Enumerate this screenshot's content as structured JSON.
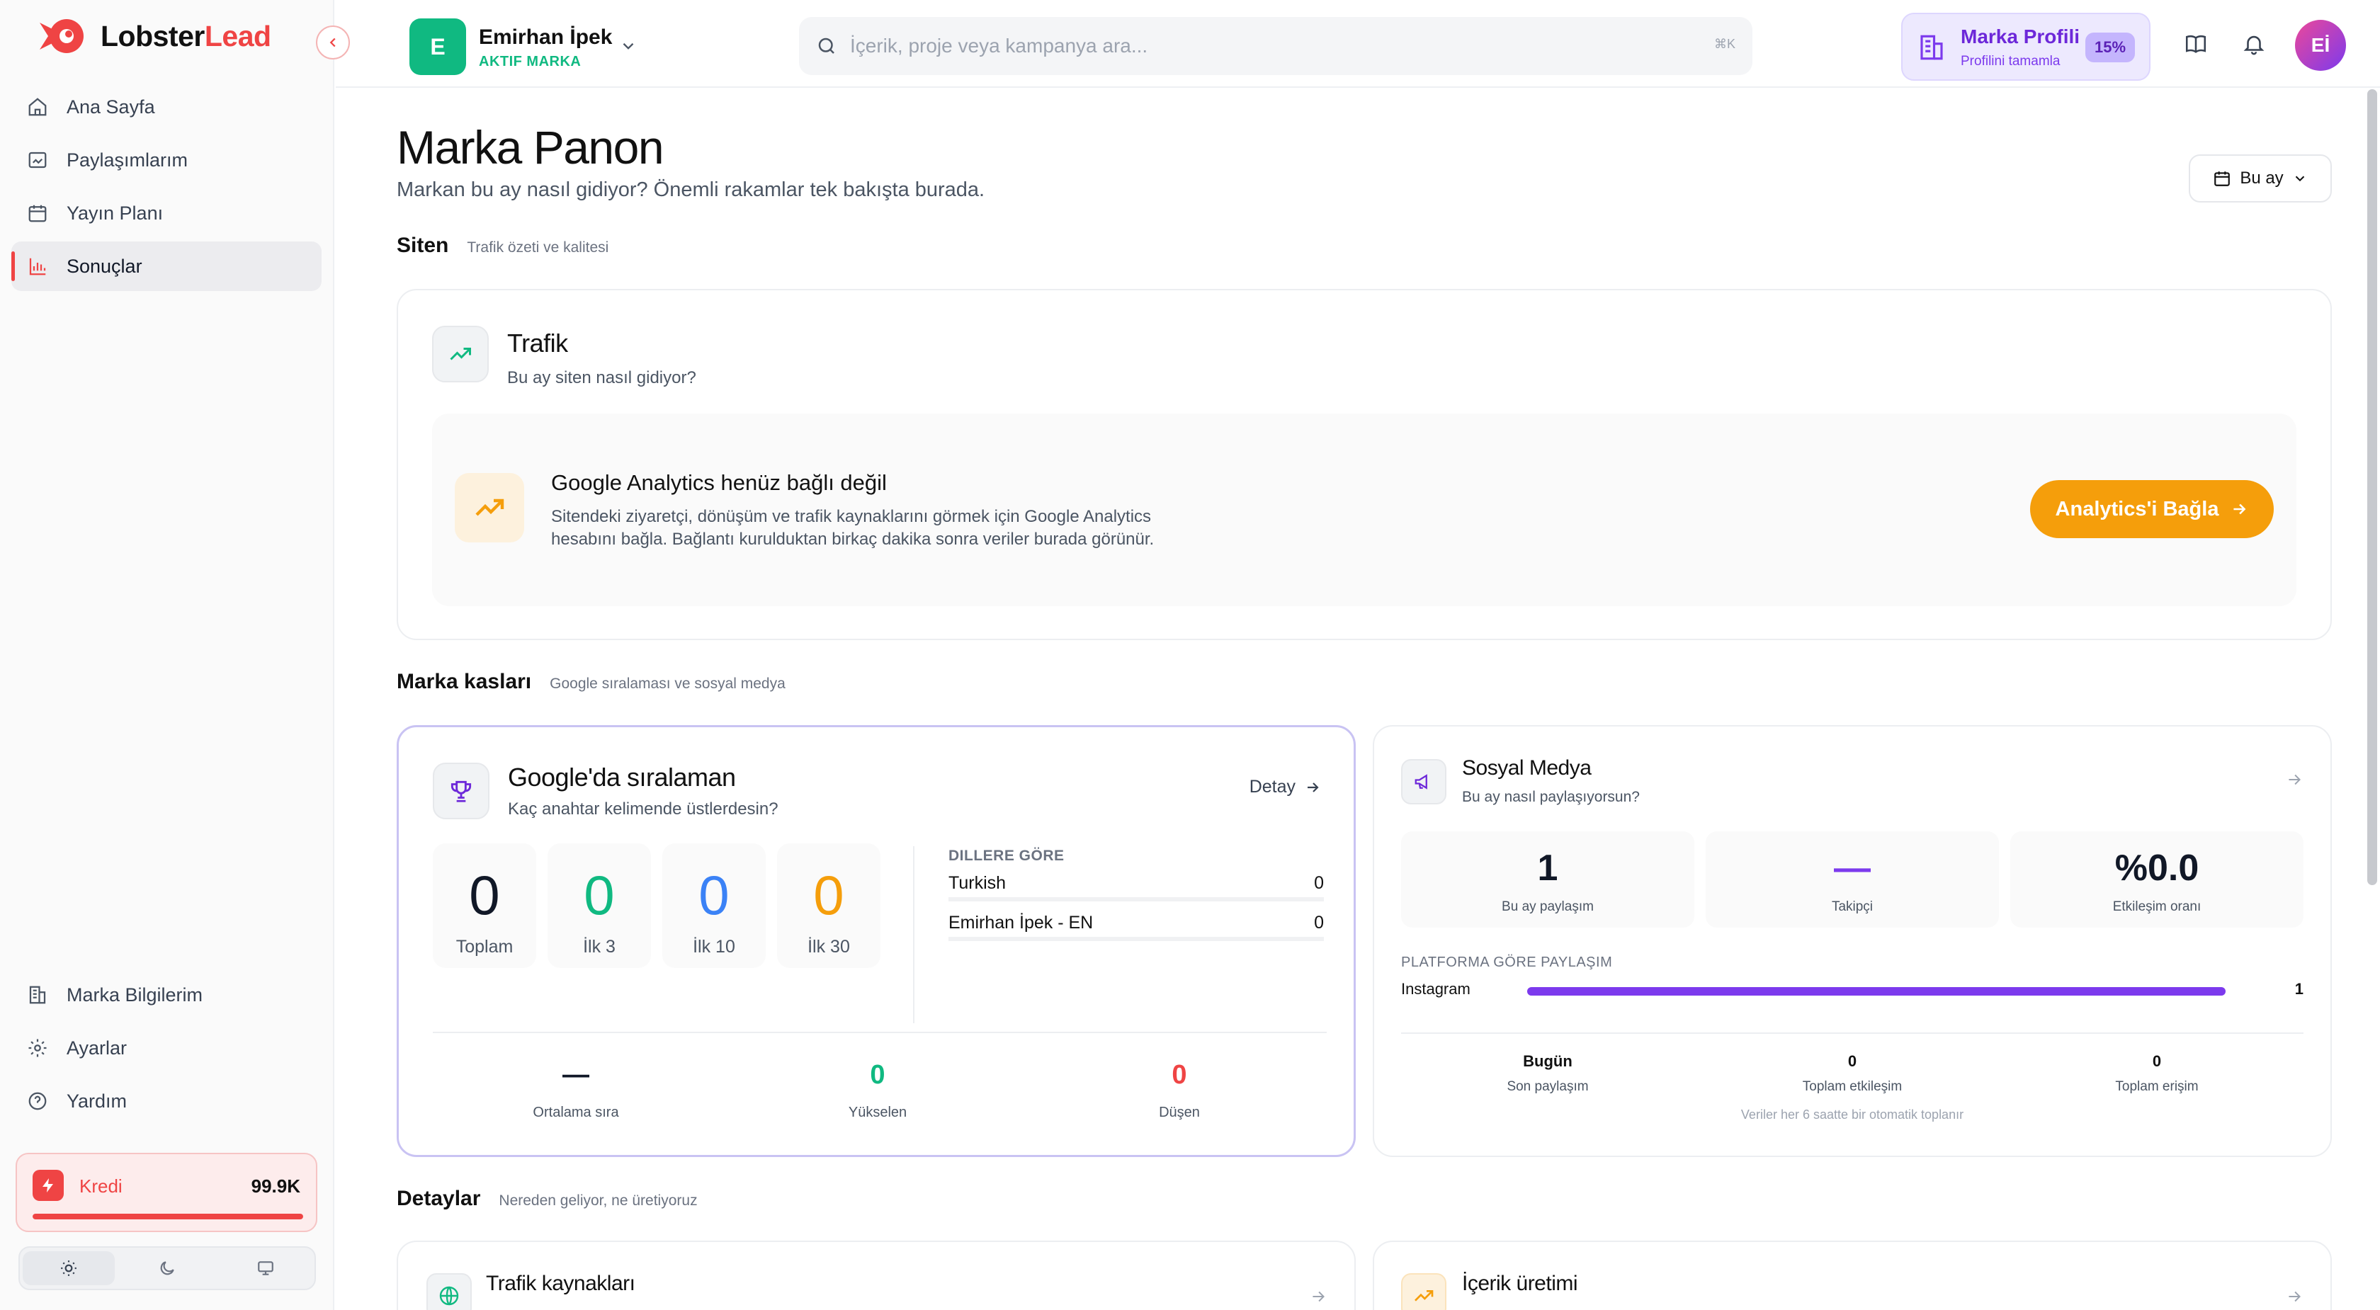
{
  "app": {
    "logo_part1": "Lobster",
    "logo_part2": "Lead"
  },
  "sidebar": {
    "nav": [
      {
        "label": "Ana Sayfa",
        "icon": "home-icon"
      },
      {
        "label": "Paylaşımlarım",
        "icon": "posts-icon"
      },
      {
        "label": "Yayın Planı",
        "icon": "calendar-icon"
      },
      {
        "label": "Sonuçlar",
        "icon": "chart-icon",
        "active": true
      }
    ],
    "bottom_nav": [
      {
        "label": "Marka Bilgilerim",
        "icon": "building-icon"
      },
      {
        "label": "Ayarlar",
        "icon": "gear-icon"
      },
      {
        "label": "Yardım",
        "icon": "help-icon"
      }
    ],
    "credit": {
      "label": "Kredi",
      "value": "99.9K",
      "fill_fraction": 0.999
    },
    "theme": [
      "light",
      "dark",
      "system"
    ]
  },
  "topbar": {
    "brand": {
      "initial": "E",
      "name": "Emirhan İpek",
      "status": "AKTIF MARKA"
    },
    "search": {
      "placeholder": "İçerik, proje veya kampanya ara...",
      "shortcut": "⌘K"
    },
    "profile": {
      "title": "Marka Profili",
      "subtitle": "Profilini tamamla",
      "percent": "15%"
    },
    "user_initials": "Eİ"
  },
  "page": {
    "title": "Marka Panon",
    "subtitle": "Markan bu ay nasıl gidiyor? Önemli rakamlar tek bakışta burada.",
    "range_label": "Bu ay"
  },
  "site_section": {
    "title": "Siten",
    "subtitle": "Trafik özeti ve kalitesi",
    "traffic": {
      "title": "Trafik",
      "subtitle": "Bu ay siten nasıl gidiyor?",
      "ga_title": "Google Analytics henüz bağlı değil",
      "ga_desc_line1": "Sitendeki ziyaretçi, dönüşüm ve trafik kaynaklarını görmek için Google Analytics",
      "ga_desc_line2": "hesabını bağla. Bağlantı kurulduktan birkaç dakika sonra veriler burada görünür.",
      "ga_button": "Analytics'i Bağla"
    }
  },
  "brand_section": {
    "title": "Marka kasları",
    "subtitle": "Google sıralaması ve sosyal medya",
    "google": {
      "title": "Google'da sıralaman",
      "subtitle": "Kaç anahtar kelimende üstlerdesin?",
      "detail": "Detay",
      "stats": [
        {
          "value": "0",
          "label": "Toplam",
          "color": "#111827"
        },
        {
          "value": "0",
          "label": "İlk 3",
          "color": "#10b981"
        },
        {
          "value": "0",
          "label": "İlk 10",
          "color": "#3b82f6"
        },
        {
          "value": "0",
          "label": "İlk 30",
          "color": "#f59e0b"
        }
      ],
      "lang_header": "DILLERE GÖRE",
      "languages": [
        {
          "name": "Turkish",
          "value": "0"
        },
        {
          "name": "Emirhan İpek - EN",
          "value": "0"
        }
      ],
      "bottom": [
        {
          "value": "—",
          "label": "Ortalama sıra",
          "color": "#111827"
        },
        {
          "value": "0",
          "label": "Yükselen",
          "color": "#10b981"
        },
        {
          "value": "0",
          "label": "Düşen",
          "color": "#ef4444"
        }
      ]
    },
    "social": {
      "title": "Sosyal Medya",
      "subtitle": "Bu ay nasıl paylaşıyorsun?",
      "stats": [
        {
          "value": "1",
          "label": "Bu ay paylaşım",
          "color": "#111827"
        },
        {
          "value": "—",
          "label": "Takipçi",
          "color": "#7c3aed"
        },
        {
          "value": "%0.0",
          "label": "Etkileşim oranı",
          "color": "#111827"
        }
      ],
      "platform_header": "PLATFORMA GÖRE PAYLAŞIM",
      "platforms": [
        {
          "name": "Instagram",
          "value": "1",
          "fraction": 1.0
        }
      ],
      "bottom": [
        {
          "value": "Bugün",
          "label": "Son paylaşım"
        },
        {
          "value": "0",
          "label": "Toplam etkileşim"
        },
        {
          "value": "0",
          "label": "Toplam erişim"
        }
      ],
      "note": "Veriler her 6 saatte bir otomatik toplanır"
    }
  },
  "details_section": {
    "title": "Detaylar",
    "subtitle": "Nereden geliyor, ne üretiyoruz",
    "cards": [
      {
        "title": "Trafik kaynakları"
      },
      {
        "title": "İçerik üretimi"
      }
    ]
  },
  "colors": {
    "accent_red": "#ef4444",
    "accent_orange": "#f59e0b",
    "accent_purple": "#7c3aed",
    "accent_green": "#10b981"
  }
}
